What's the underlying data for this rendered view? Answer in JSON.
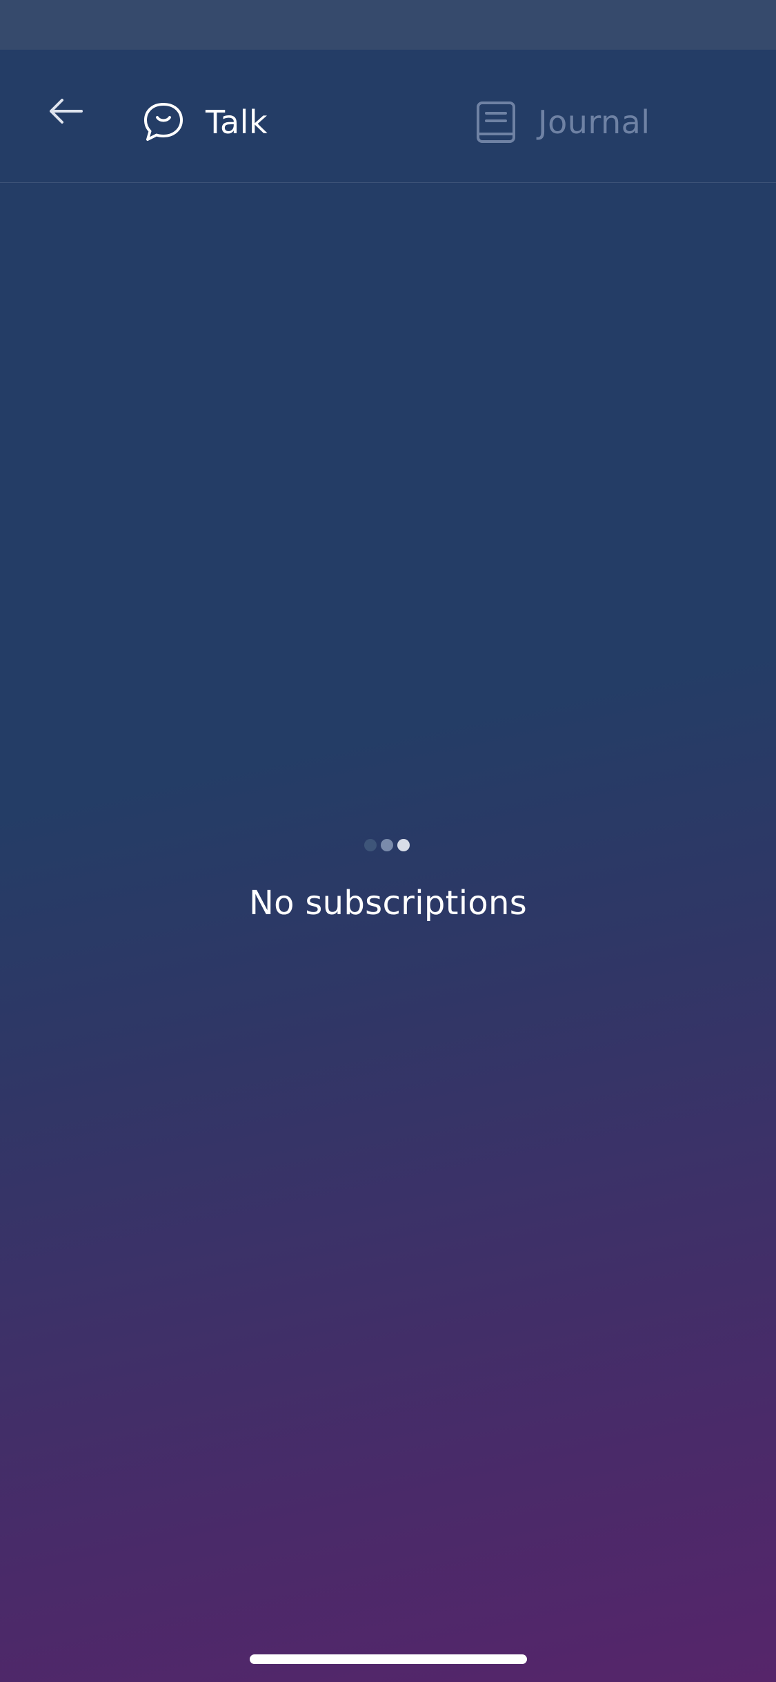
{
  "header": {
    "back_icon": "arrow-left-icon",
    "tabs": [
      {
        "label": "Talk",
        "icon": "chat-bubble-icon",
        "active": true
      },
      {
        "label": "Journal",
        "icon": "journal-icon",
        "active": false
      }
    ]
  },
  "main": {
    "loader_icon": "three-dot-loader",
    "empty_message": "No subscriptions"
  },
  "colors": {
    "background_top": "#243d66",
    "background_bottom": "#56256a",
    "active_tab": "#ffffff",
    "inactive_tab": "#6f82a4"
  }
}
